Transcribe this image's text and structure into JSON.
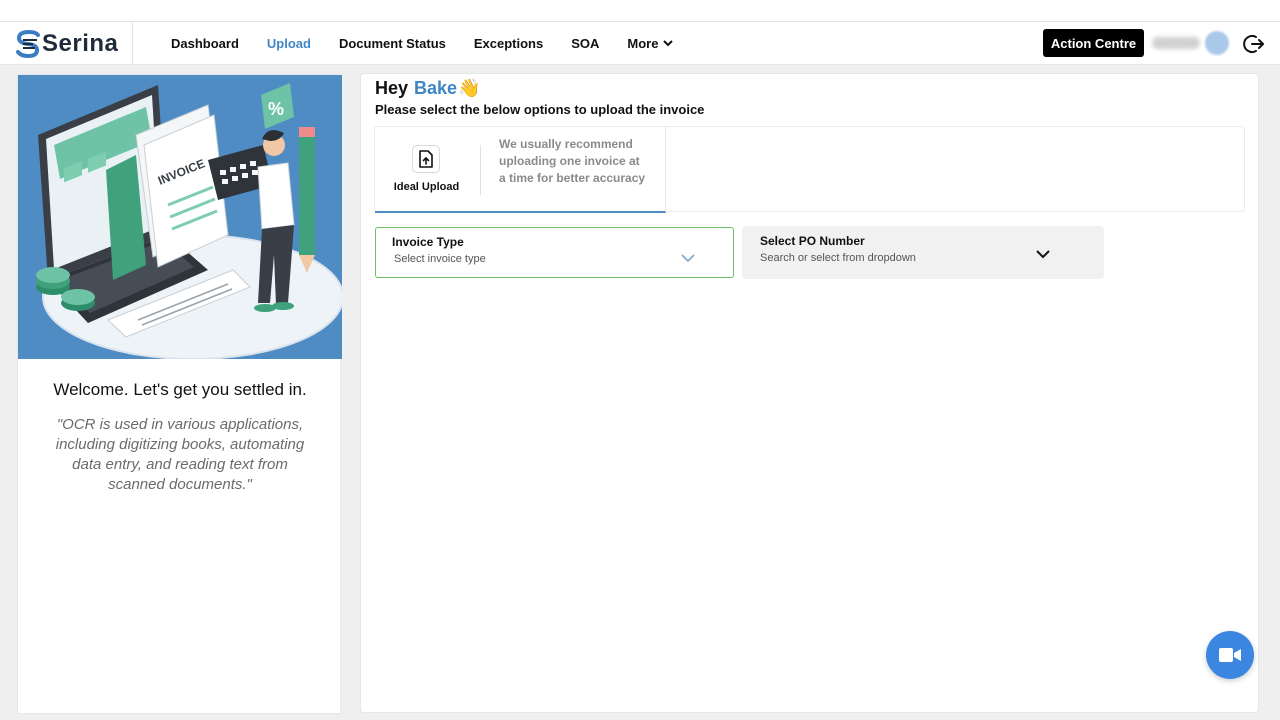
{
  "brand": {
    "name": "Serina"
  },
  "nav": {
    "items": [
      {
        "label": "Dashboard",
        "active": false
      },
      {
        "label": "Upload",
        "active": true
      },
      {
        "label": "Document Status",
        "active": false
      },
      {
        "label": "Exceptions",
        "active": false
      },
      {
        "label": "SOA",
        "active": false
      },
      {
        "label": "More",
        "active": false,
        "has_dropdown": true
      }
    ],
    "action_button": "Action Centre"
  },
  "colors": {
    "accent": "#3f86c6",
    "illustration_bg": "#4e8cc3",
    "success_border": "#6cbf64",
    "video_button": "#3a86e0"
  },
  "left_panel": {
    "welcome": "Welcome. Let's get you settled in.",
    "quote": "\"OCR is used in various applications, including digitizing books, automating data entry, and reading text from scanned documents.\"",
    "illustration_text": "INVOICE"
  },
  "main": {
    "greeting_prefix": "Hey",
    "greeting_name": "Bake",
    "greeting_emoji": "👋",
    "subtitle": "Please select the below options to upload the invoice",
    "upload_option": {
      "label": "Ideal Upload",
      "description": "We usually recommend uploading one invoice at a time for better accuracy",
      "icon": "file-upload-icon"
    },
    "invoice_type": {
      "label": "Invoice Type",
      "placeholder": "Select invoice type"
    },
    "po_number": {
      "label": "Select PO Number",
      "placeholder": "Search or select from dropdown"
    }
  },
  "icons": {
    "logout": "logout-icon",
    "video": "video-camera-icon",
    "chevron": "chevron-down-icon"
  }
}
